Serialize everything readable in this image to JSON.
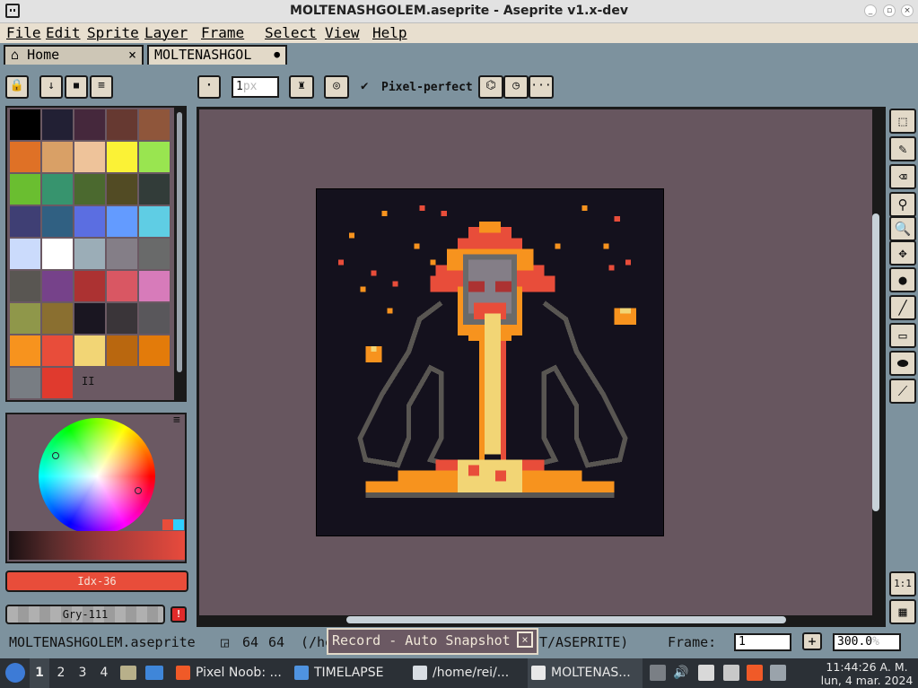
{
  "window": {
    "title": "MOLTENASHGOLEM.aseprite - Aseprite v1.x-dev",
    "controls": [
      "_",
      "▫",
      "×"
    ]
  },
  "menu": [
    "File",
    "Edit",
    "Sprite",
    "Layer",
    "Frame",
    "Select",
    "View",
    "Help"
  ],
  "tabs": [
    {
      "label": "Home",
      "icon": "home-icon",
      "close": "×"
    },
    {
      "label": "MOLTENASHGOL",
      "modified_mark": "●"
    }
  ],
  "layers_toolbar": {
    "lock": "lock-icon",
    "down": "↓",
    "new": "■",
    "menu": "≡"
  },
  "tool_options": {
    "brush_type": "·",
    "brush_size": "1",
    "brush_unit": "px",
    "pixel_perfect_label": "Pixel-perfect",
    "pixel_perfect_checked": true,
    "extra": "···"
  },
  "palette": {
    "colors": [
      "#000000",
      "#222034",
      "#45283c",
      "#663931",
      "#8f563b",
      "#df7126",
      "#d9a066",
      "#eec39a",
      "#fbf236",
      "#99e550",
      "#6abe30",
      "#37946e",
      "#4b692f",
      "#524b24",
      "#323c39",
      "#3f3f74",
      "#306082",
      "#5b6ee1",
      "#639bff",
      "#5fcde4",
      "#cbdbfc",
      "#ffffff",
      "#9badb7",
      "#847e87",
      "#696a6a",
      "#595652",
      "#76428a",
      "#ac3232",
      "#d95763",
      "#d77bba",
      "#8f974a",
      "#8a6f30",
      "#1a1621",
      "#3a3539",
      "#59575b",
      "#f7931e",
      "#e84d3a",
      "#f2d575",
      "#b9670f",
      "#e37b0a",
      "#787d83",
      "#e03a2e"
    ],
    "pause_glyph": "II"
  },
  "color_bars": {
    "fg_label": "Idx-36",
    "fg_color": "#e84d3a",
    "bg_label": "Gry-111",
    "warning": "!"
  },
  "status": {
    "filename": "MOLTENASHGOLEM.aseprite",
    "size_w": "64",
    "size_h": "64",
    "path_left": "(/he",
    "path_right": "T/ASEPRITE)",
    "frame_label": "Frame:",
    "frame_value": "1",
    "plus": "+",
    "zoom_value": "300.0",
    "zoom_unit": "%"
  },
  "record_popup": {
    "label": "Record - Auto Snapshot",
    "close": "×"
  },
  "right_tools": [
    "marquee",
    "pencil",
    "eraser",
    "eyedropper",
    "zoom",
    "move",
    "fill",
    "line",
    "rectangle",
    "ellipse",
    "blur"
  ],
  "right_bottom": [
    "1:1",
    "filmstrip"
  ],
  "taskbar": {
    "workspaces": [
      "1",
      "2",
      "3",
      "4"
    ],
    "tasks": [
      {
        "label": "Pixel Noob: ...",
        "icon": "brave-icon"
      },
      {
        "label": "TIMELAPSE",
        "icon": "folder-icon"
      },
      {
        "label": "/home/rei/...",
        "icon": "editor-icon"
      },
      {
        "label": "MOLTENAS...",
        "icon": "aseprite-icon"
      }
    ],
    "clock_time": "11:44:26 A. M.",
    "clock_date": "lun, 4 mar. 2024"
  }
}
